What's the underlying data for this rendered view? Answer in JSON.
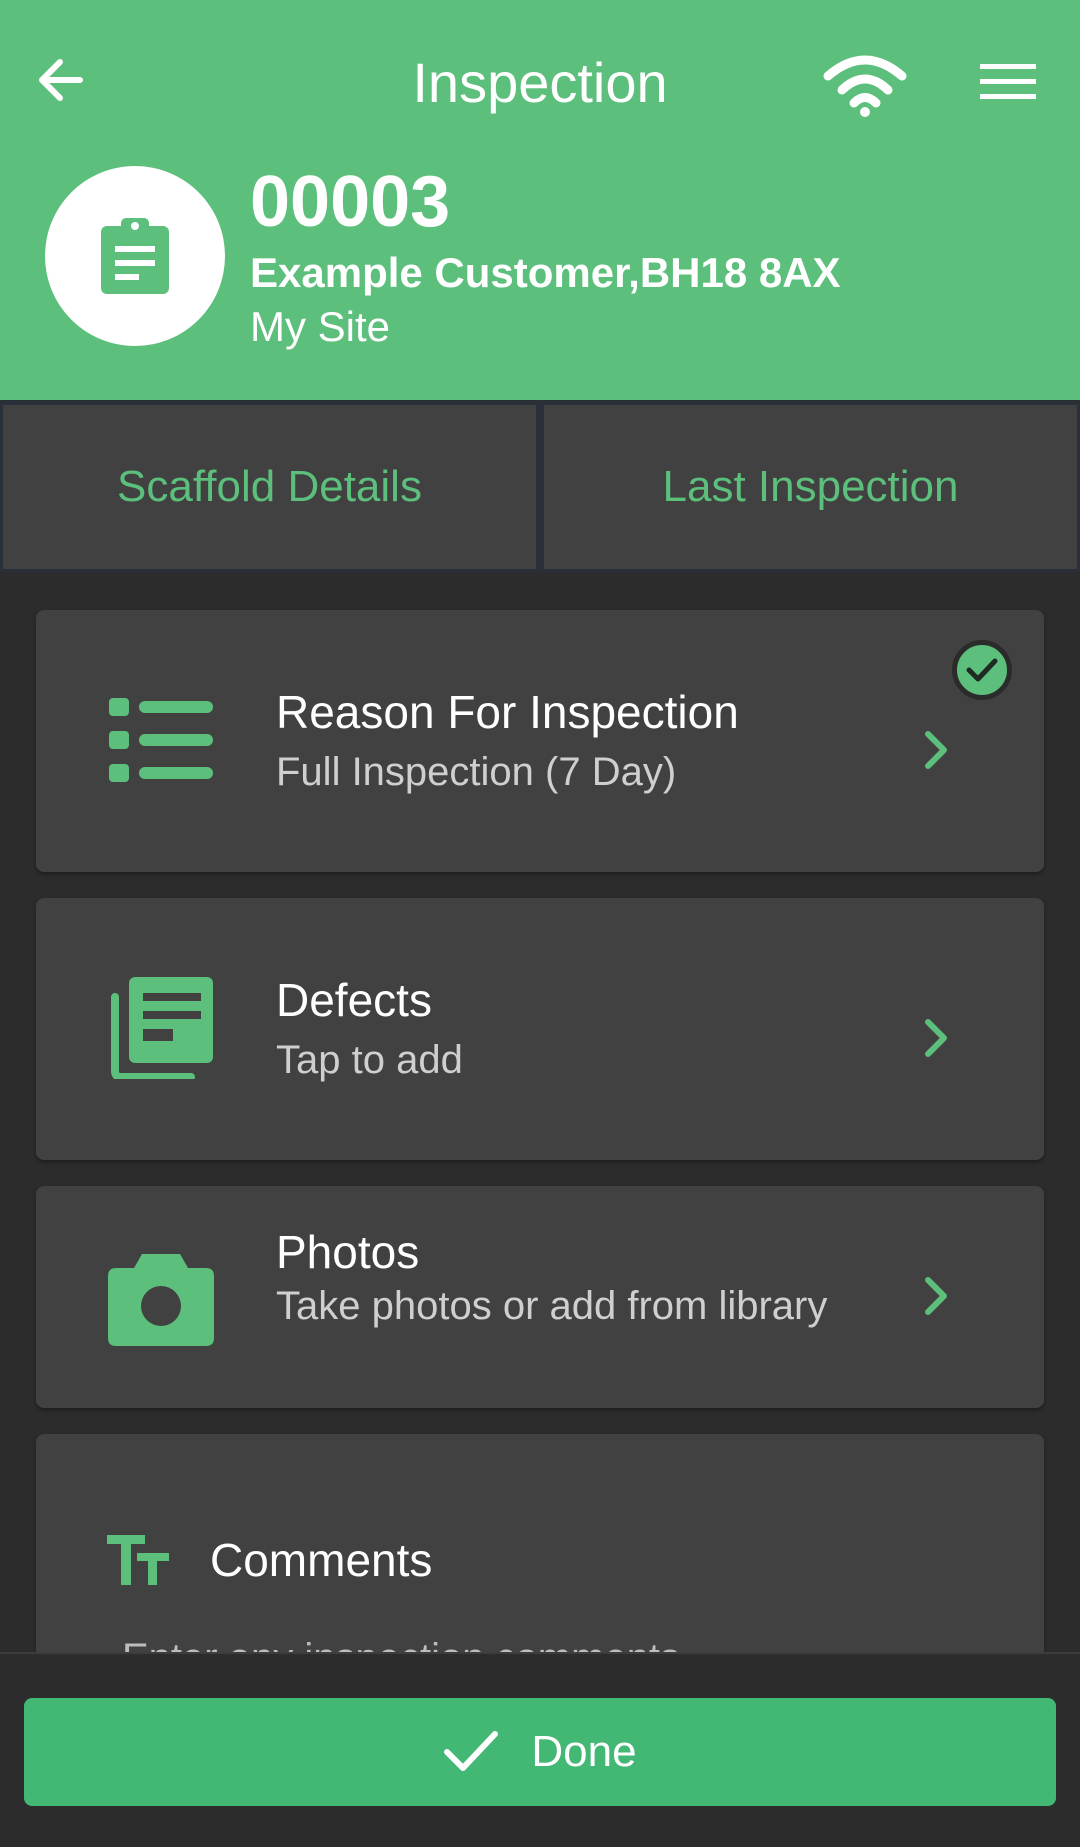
{
  "header": {
    "title": "Inspection",
    "job_number": "00003",
    "customer": "Example Customer,BH18 8AX",
    "site": "My Site"
  },
  "tabs": [
    {
      "label": "Scaffold Details"
    },
    {
      "label": "Last Inspection"
    }
  ],
  "cards": {
    "reason": {
      "title": "Reason For Inspection",
      "subtitle": "Full Inspection (7 Day)",
      "completed": true
    },
    "defects": {
      "title": "Defects",
      "subtitle": "Tap to add"
    },
    "photos": {
      "title": "Photos",
      "subtitle": "Take photos or add from library"
    },
    "comments": {
      "label": "Comments",
      "placeholder": "Enter any inspection comments"
    }
  },
  "footer": {
    "done_label": "Done"
  },
  "colors": {
    "accent": "#5cbf7c",
    "button": "#43b874",
    "card": "#414141",
    "background": "#2c2c2c"
  },
  "icons": [
    "arrow-left-icon",
    "wifi-icon",
    "hamburger-menu-icon",
    "clipboard-icon",
    "list-icon",
    "documents-icon",
    "camera-icon",
    "text-size-icon",
    "chevron-right-icon",
    "checkmark-icon"
  ]
}
